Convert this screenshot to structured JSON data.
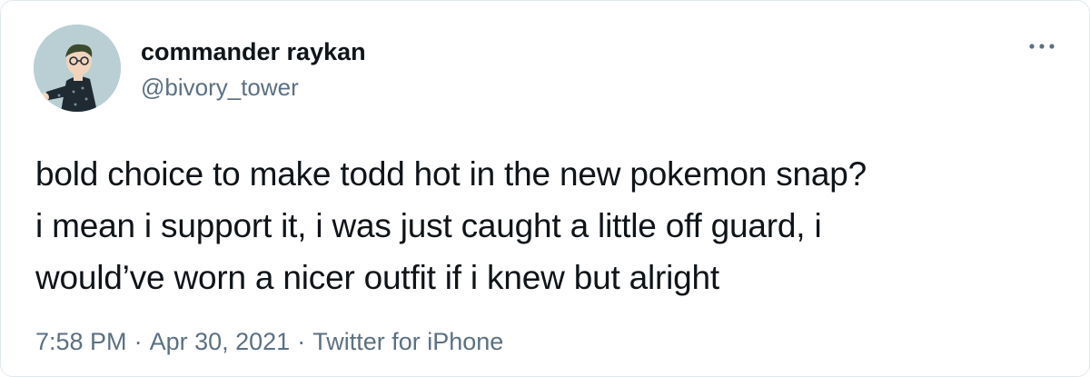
{
  "author": {
    "display_name": "commander raykan",
    "handle": "@bivory_tower",
    "avatar_icon": "cartoon-avatar"
  },
  "menu": {
    "icon": "more-dots-icon"
  },
  "tweet": {
    "lines": [
      "bold choice to make todd hot in the new pokemon snap?",
      "i mean i support it, i was just caught a little off guard, i",
      "would’ve worn a nicer outfit if i knew but alright"
    ]
  },
  "meta": {
    "time": "7:58 PM",
    "separator": "·",
    "date": "Apr 30, 2021",
    "source": "Twitter for iPhone"
  },
  "colors": {
    "text": "#0f1419",
    "secondary": "#5b7083",
    "avatar_bg": "#b9cfd4"
  }
}
